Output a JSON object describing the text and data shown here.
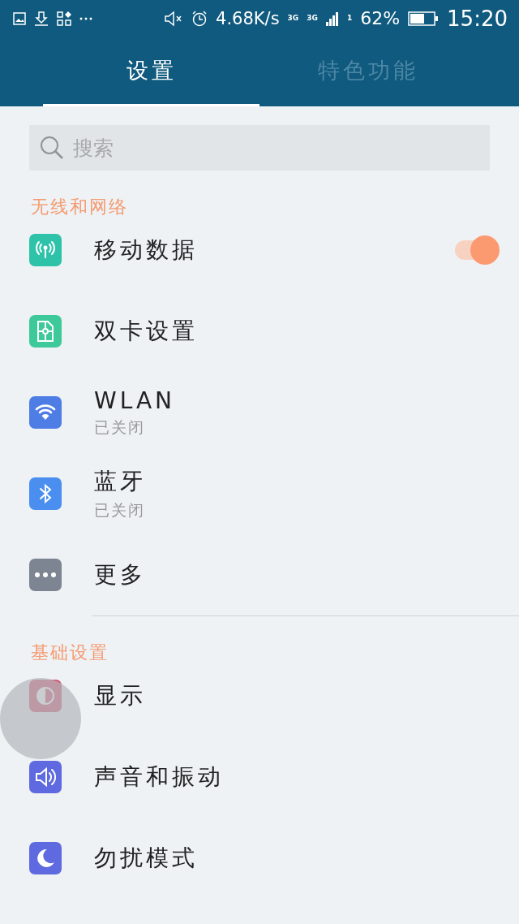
{
  "status_bar": {
    "speed": "4.68K/s",
    "network_labels": [
      "3G",
      "3G"
    ],
    "sim_index": "1",
    "battery": "62%",
    "time": "15:20"
  },
  "tabs": [
    {
      "label": "设置",
      "selected": true
    },
    {
      "label": "特色功能",
      "selected": false
    }
  ],
  "search": {
    "placeholder": "搜索"
  },
  "sections": [
    {
      "title": "无线和网络",
      "items": [
        {
          "kind": "toggle",
          "label": "移动数据",
          "on": true
        },
        {
          "kind": "link",
          "label": "双卡设置"
        },
        {
          "kind": "link",
          "label": "WLAN",
          "subtitle": "已关闭"
        },
        {
          "kind": "link",
          "label": "蓝牙",
          "subtitle": "已关闭"
        },
        {
          "kind": "link",
          "label": "更多"
        }
      ]
    },
    {
      "title": "基础设置",
      "items": [
        {
          "kind": "link",
          "label": "显示"
        },
        {
          "kind": "link",
          "label": "声音和振动"
        },
        {
          "kind": "link",
          "label": "勿扰模式"
        }
      ]
    }
  ]
}
